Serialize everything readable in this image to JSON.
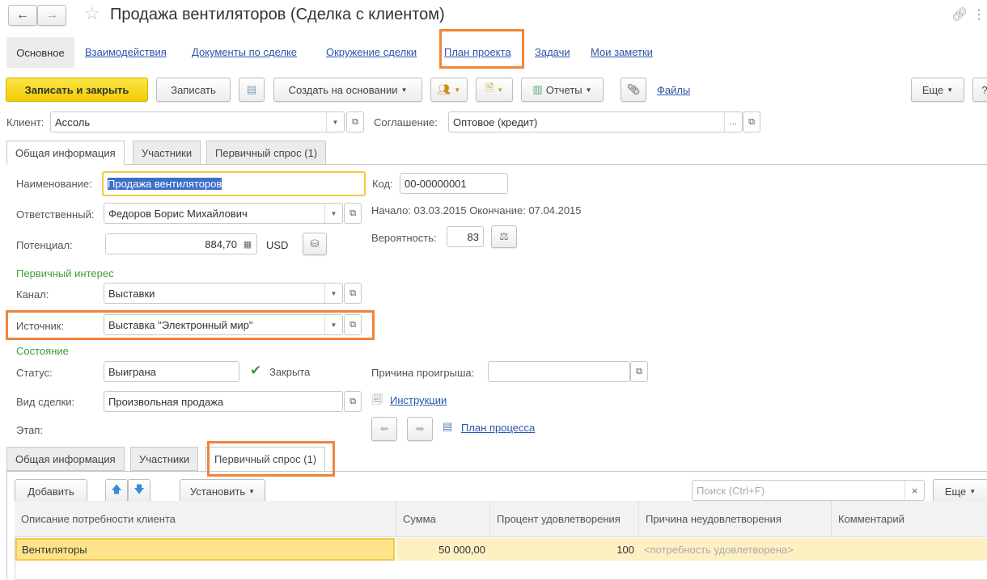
{
  "window": {
    "title": "Продажа вентиляторов (Сделка с клиентом)"
  },
  "nav": {
    "tabs": [
      "Основное",
      "Взаимодействия",
      "Документы по сделке",
      "Окружение сделки",
      "План проекта",
      "Задачи",
      "Мои заметки"
    ]
  },
  "toolbar": {
    "save_close": "Записать и закрыть",
    "save": "Записать",
    "create_based": "Создать на основании",
    "reports": "Отчеты",
    "files": "Файлы",
    "more": "Еще",
    "help": "?"
  },
  "header": {
    "client_label": "Клиент:",
    "client": "Ассоль",
    "agreement_label": "Соглашение:",
    "agreement": "Оптовое (кредит)",
    "agreement_more": "..."
  },
  "tabs": [
    "Общая информация",
    "Участники",
    "Первичный спрос (1)"
  ],
  "form": {
    "name_label": "Наименование:",
    "name": "Продажа вентиляторов",
    "code_label": "Код:",
    "code": "00-00000001",
    "resp_label": "Ответственный:",
    "resp": "Федоров Борис Михайлович",
    "dates": "Начало: 03.03.2015 Окончание: 07.04.2015",
    "potential_label": "Потенциал:",
    "potential": "884,70",
    "currency": "USD",
    "prob_label": "Вероятность:",
    "prob": "83",
    "interest_group": "Первичный интерес",
    "channel_label": "Канал:",
    "channel": "Выставки",
    "source_label": "Источник:",
    "source": "Выставка \"Электронный мир\"",
    "state_group": "Состояние",
    "status_label": "Статус:",
    "status": "Выиграна",
    "closed_label": "Закрыта",
    "loss_label": "Причина проигрыша:",
    "loss": "",
    "kind_label": "Вид сделки:",
    "kind": "Произвольная продажа",
    "instructions": "Инструкции",
    "stage_label": "Этап:",
    "process_plan": "План процесса"
  },
  "table_toolbar": {
    "add": "Добавить",
    "set": "Установить",
    "search_placeholder": "Поиск (Ctrl+F)",
    "clear": "×",
    "more": "Еще"
  },
  "table": {
    "columns": [
      "Описание потребности клиента",
      "Сумма",
      "Процент удовлетворения",
      "Причина неудовлетворения",
      "Комментарий"
    ],
    "rows": [
      [
        "Вентиляторы",
        "50 000,00",
        "100",
        "<потребность удовлетворена>",
        ""
      ]
    ]
  }
}
